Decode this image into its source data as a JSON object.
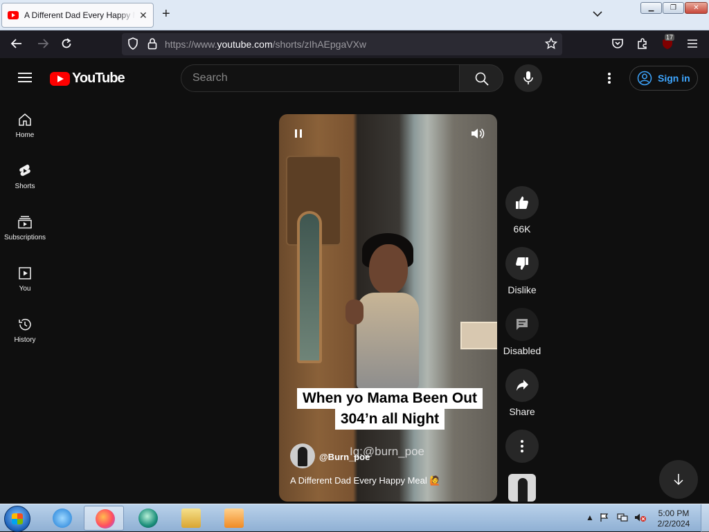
{
  "browser": {
    "tab_title": "A Different Dad Every Happy Meal",
    "url_prefix": "https://www.",
    "url_domain": "youtube.com",
    "url_path": "/shorts/zIhAEpgaVXw",
    "extensions_badge": "17"
  },
  "youtube": {
    "logo_text": "YouTube",
    "search_placeholder": "Search",
    "sign_in_label": "Sign in",
    "sidebar": [
      {
        "label": "Home",
        "icon": "home-icon"
      },
      {
        "label": "Shorts",
        "icon": "shorts-icon"
      },
      {
        "label": "Subscriptions",
        "icon": "subscriptions-icon"
      },
      {
        "label": "You",
        "icon": "you-icon"
      },
      {
        "label": "History",
        "icon": "history-icon"
      }
    ],
    "video": {
      "overlay_line1": "When yo Mama Been Out",
      "overlay_line2": "304’n all Night",
      "watermark": "Ig:@burn_poe",
      "channel": "@Burn_poe",
      "title": "A Different Dad Every Happy Meal 🙋"
    },
    "actions": {
      "like_count": "66K",
      "dislike_label": "Dislike",
      "comments_label": "Disabled",
      "share_label": "Share"
    }
  },
  "taskbar": {
    "time": "5:00 PM",
    "date": "2/2/2024"
  },
  "colors": {
    "yt_red": "#ff0000",
    "link_blue": "#3ea6ff",
    "page_bg": "#0f0f0f"
  }
}
